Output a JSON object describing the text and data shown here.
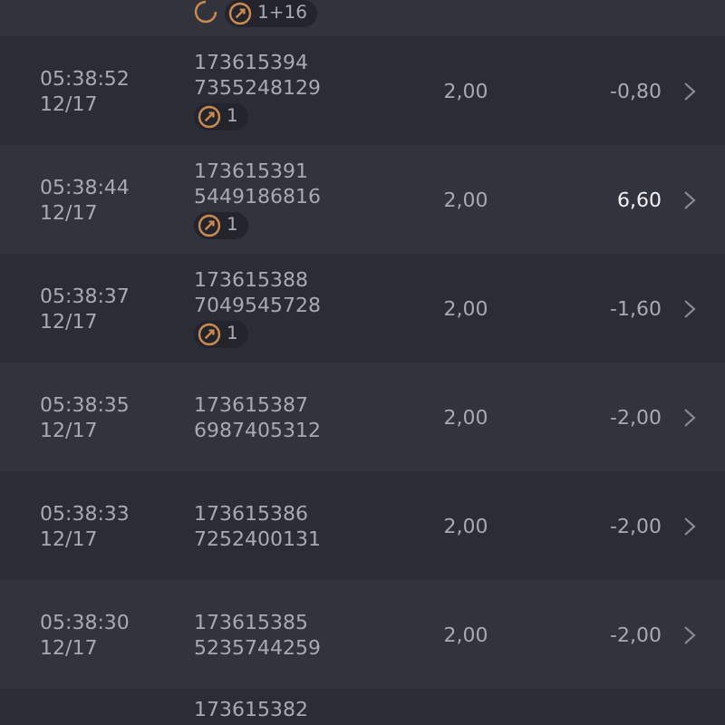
{
  "rows": [
    {
      "kind": "partial-top",
      "badge": "1+16"
    },
    {
      "kind": "full",
      "time": "05:38:52",
      "date": "12/17",
      "id_line_1": "173615394",
      "id_line_2": "7355248129",
      "badge": "1",
      "amount": "2,00",
      "result": "-0,80",
      "positive": false
    },
    {
      "kind": "full",
      "time": "05:38:44",
      "date": "12/17",
      "id_line_1": "173615391",
      "id_line_2": "5449186816",
      "badge": "1",
      "amount": "2,00",
      "result": "6,60",
      "positive": true
    },
    {
      "kind": "full",
      "time": "05:38:37",
      "date": "12/17",
      "id_line_1": "173615388",
      "id_line_2": "7049545728",
      "badge": "1",
      "amount": "2,00",
      "result": "-1,60",
      "positive": false
    },
    {
      "kind": "full",
      "time": "05:38:35",
      "date": "12/17",
      "id_line_1": "173615387",
      "id_line_2": "6987405312",
      "amount": "2,00",
      "result": "-2,00",
      "positive": false
    },
    {
      "kind": "full",
      "time": "05:38:33",
      "date": "12/17",
      "id_line_1": "173615386",
      "id_line_2": "7252400131",
      "amount": "2,00",
      "result": "-2,00",
      "positive": false
    },
    {
      "kind": "full",
      "time": "05:38:30",
      "date": "12/17",
      "id_line_1": "173615385",
      "id_line_2": "5235744259",
      "amount": "2,00",
      "result": "-2,00",
      "positive": false
    },
    {
      "kind": "partial-bottom",
      "id_line_1": "173615382"
    }
  ]
}
